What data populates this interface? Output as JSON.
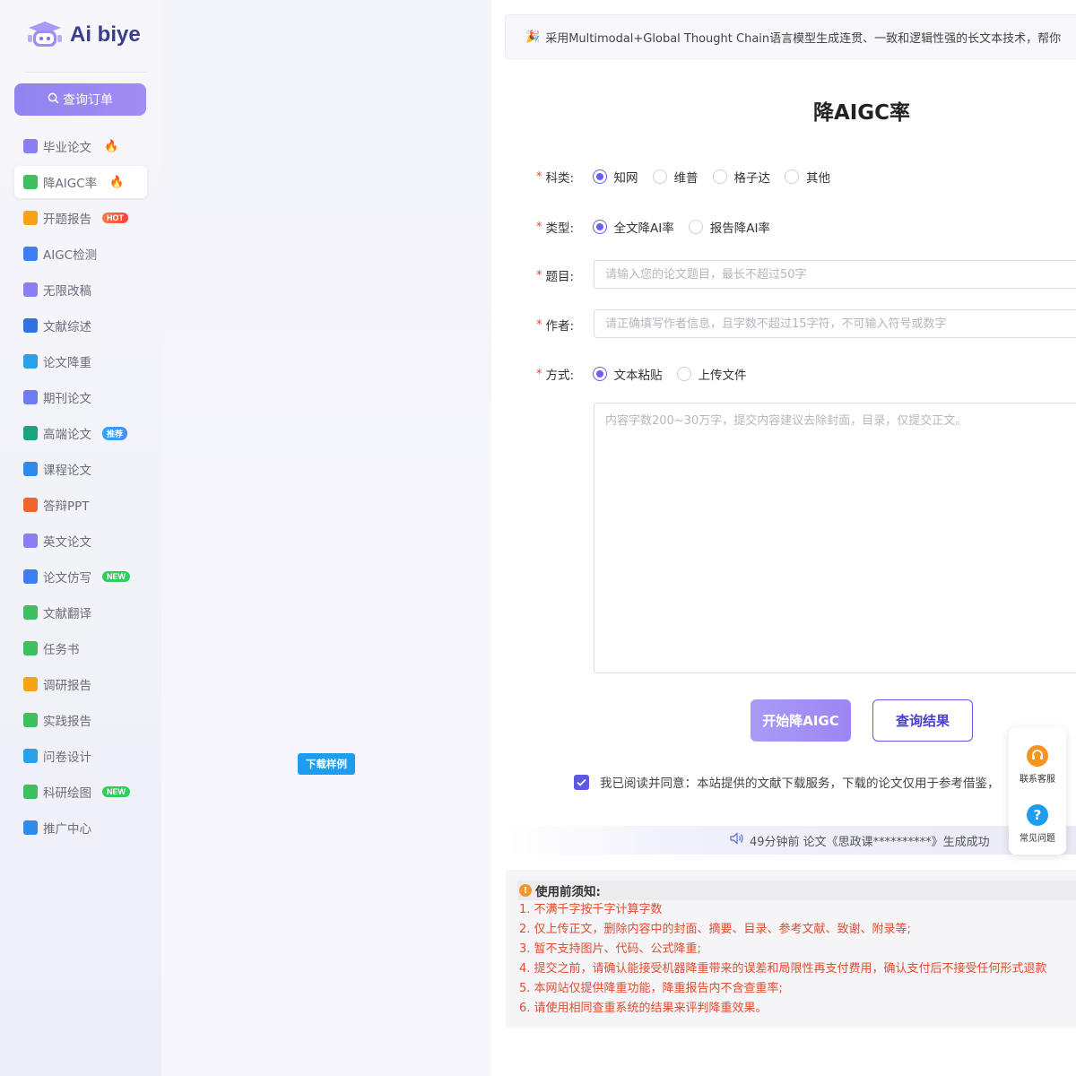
{
  "sidebar": {
    "brand": "Ai biye",
    "search_button": "查询订单",
    "items": [
      {
        "label": "毕业论文",
        "icon": "graduation-cap-icon",
        "color": "#8a7ff0",
        "fire": "🔥",
        "badge": ""
      },
      {
        "label": "降AIGC率",
        "icon": "ai-shield-icon",
        "color": "#3fbf5f",
        "fire": "🔥",
        "badge": ""
      },
      {
        "label": "开题报告",
        "icon": "document-icon",
        "color": "#f7a21b",
        "fire": "",
        "badge": "HOT"
      },
      {
        "label": "AIGC检测",
        "icon": "ai-detect-icon",
        "color": "#3b7ff0",
        "fire": "",
        "badge": ""
      },
      {
        "label": "无限改稿",
        "icon": "rewrite-icon",
        "color": "#8a7ff0",
        "fire": "",
        "badge": ""
      },
      {
        "label": "文献综述",
        "icon": "book-icon",
        "color": "#2f73e0",
        "fire": "",
        "badge": ""
      },
      {
        "label": "论文降重",
        "icon": "chart-down-icon",
        "color": "#2aa0e8",
        "fire": "",
        "badge": ""
      },
      {
        "label": "期刊论文",
        "icon": "journal-icon",
        "color": "#6f7cf0",
        "fire": "",
        "badge": ""
      },
      {
        "label": "高端论文",
        "icon": "openai-icon",
        "color": "#19a37f",
        "fire": "",
        "badge": "推荐"
      },
      {
        "label": "课程论文",
        "icon": "course-book-icon",
        "color": "#2f8ae8",
        "fire": "",
        "badge": ""
      },
      {
        "label": "答辩PPT",
        "icon": "ppt-icon",
        "color": "#f0642e",
        "fire": "",
        "badge": ""
      },
      {
        "label": "英文论文",
        "icon": "graduation-cap-icon",
        "color": "#8a7ff0",
        "fire": "",
        "badge": ""
      },
      {
        "label": "论文仿写",
        "icon": "pen-paper-icon",
        "color": "#3b7ff0",
        "fire": "",
        "badge": "NEW"
      },
      {
        "label": "文献翻译",
        "icon": "translate-icon",
        "color": "#3fbf5f",
        "fire": "",
        "badge": ""
      },
      {
        "label": "任务书",
        "icon": "task-check-icon",
        "color": "#3fbf5f",
        "fire": "",
        "badge": ""
      },
      {
        "label": "调研报告",
        "icon": "survey-icon",
        "color": "#f7a21b",
        "fire": "",
        "badge": ""
      },
      {
        "label": "实践报告",
        "icon": "practice-icon",
        "color": "#3fbf5f",
        "fire": "",
        "badge": ""
      },
      {
        "label": "问卷设计",
        "icon": "questionnaire-icon",
        "color": "#2aa0e8",
        "fire": "",
        "badge": ""
      },
      {
        "label": "科研绘图",
        "icon": "image-icon",
        "color": "#3fbf5f",
        "fire": "",
        "badge": "NEW"
      },
      {
        "label": "推广中心",
        "icon": "paper-plane-icon",
        "color": "#2f8ae8",
        "fire": "",
        "badge": ""
      }
    ]
  },
  "middle": {
    "download_sample": "下载样例"
  },
  "announce": {
    "icon": "party-popper-icon",
    "text": "采用Multimodal+Global Thought Chain语言模型生成连贯、一致和逻辑性强的长文本技术，帮你"
  },
  "form": {
    "title": "降AIGC率",
    "category": {
      "label": "科类:",
      "options": [
        "知网",
        "维普",
        "格子达",
        "其他"
      ],
      "selected": "知网"
    },
    "type": {
      "label": "类型:",
      "options": [
        "全文降AI率",
        "报告降AI率"
      ],
      "selected": "全文降AI率"
    },
    "topic": {
      "label": "题目:",
      "placeholder": "请输入您的论文题目，最长不超过50字"
    },
    "author": {
      "label": "作者:",
      "placeholder": "请正确填写作者信息，且字数不超过15字符，不可输入符号或数字"
    },
    "method": {
      "label": "方式:",
      "options": [
        "文本粘贴",
        "上传文件"
      ],
      "selected": "文本粘贴"
    },
    "content_placeholder": "内容字数200~30万字，提交内容建议去除封面，目录，仅提交正文。",
    "start_button": "开始降AIGC",
    "query_button": "查询结果",
    "agree_text": "我已阅读并同意：本站提供的文献下载服务，下载的论文仅用于参考借鉴，"
  },
  "ticker": {
    "icon": "speaker-icon",
    "text": "49分钟前 论文《思政课**********》生成成功"
  },
  "notice": {
    "title": "使用前须知:",
    "lines": [
      "1. 不满千字按千字计算字数",
      "2. 仅上传正文，删除内容中的封面、摘要、目录、参考文献、致谢、附录等;",
      "3. 暂不支持图片、代码、公式降重;",
      "4. 提交之前，请确认能接受机器降重带来的误差和局限性再支付费用，确认支付后不接受任何形式退款",
      "5. 本网站仅提供降重功能，降重报告内不含查重率;",
      "6. 请使用相同查重系统的结果来评判降重效果。"
    ]
  },
  "float_panel": {
    "service": "联系客服",
    "faq": "常见问题"
  }
}
